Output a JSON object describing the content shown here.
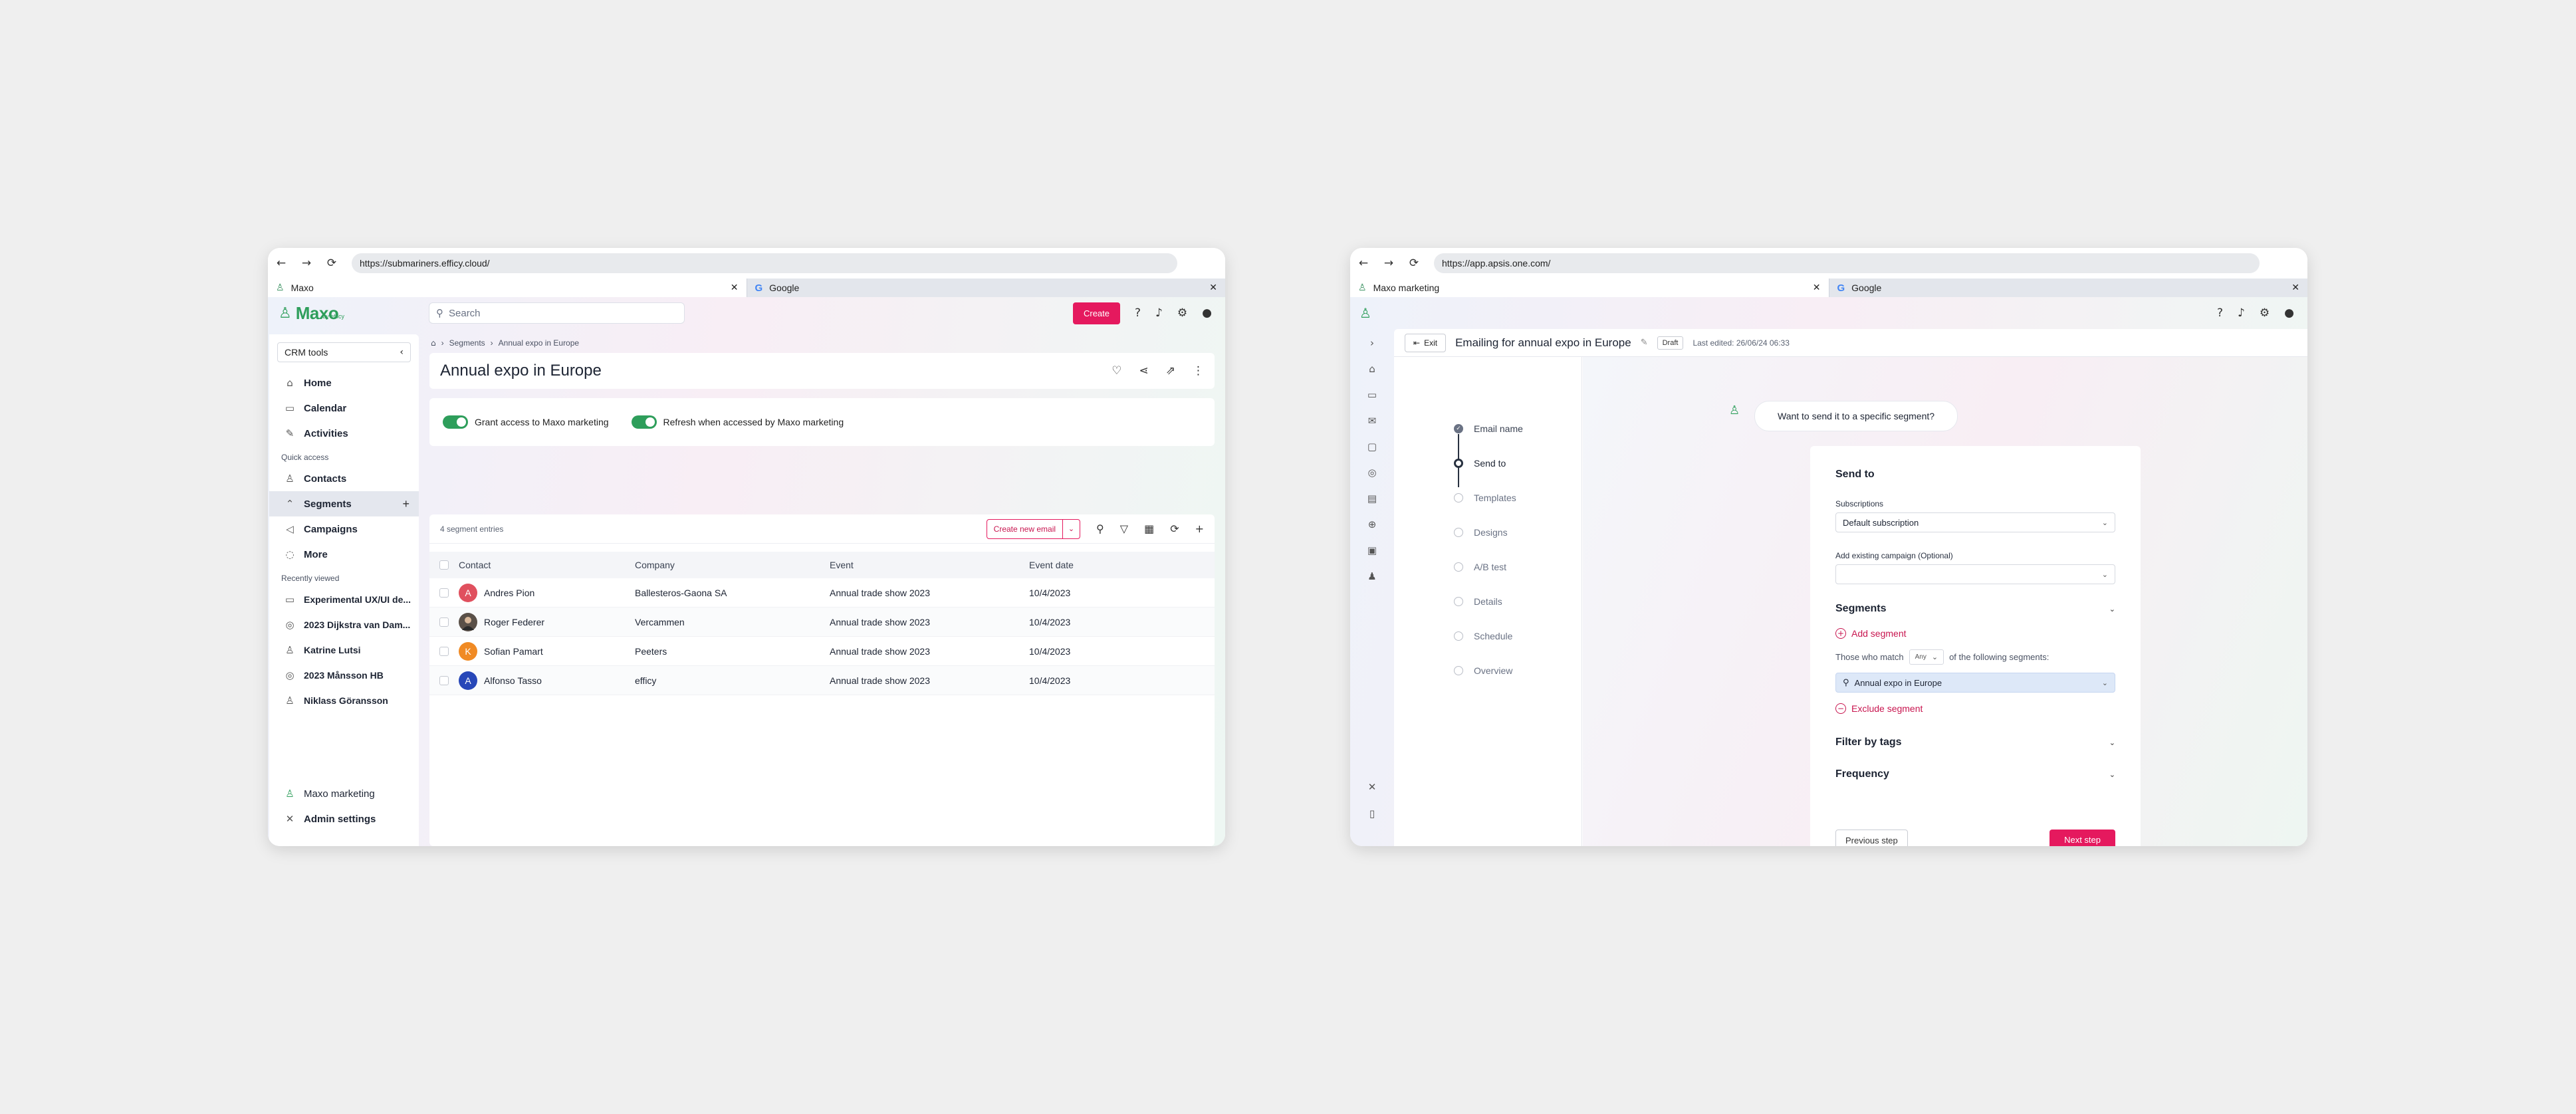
{
  "left_window": {
    "url": "https://submariners.efficy.cloud/",
    "tabs": [
      {
        "label": "Maxo"
      },
      {
        "label": "Google"
      }
    ],
    "brand": {
      "name": "Maxo",
      "by": "by efficy"
    },
    "search_placeholder": "Search",
    "create_label": "Create",
    "sidebar": {
      "crm_tools": "CRM tools",
      "main_items": [
        {
          "label": "Home",
          "icon": "home-icon"
        },
        {
          "label": "Calendar",
          "icon": "calendar-icon"
        },
        {
          "label": "Activities",
          "icon": "activities-icon"
        }
      ],
      "quick_access_title": "Quick access",
      "quick_items": [
        {
          "label": "Contacts",
          "icon": "contact-icon"
        },
        {
          "label": "Segments",
          "icon": "segments-icon"
        },
        {
          "label": "Campaigns",
          "icon": "megaphone-icon"
        },
        {
          "label": "More",
          "icon": "more-icon"
        }
      ],
      "recent_title": "Recently viewed",
      "recent_items": [
        {
          "label": "Experimental UX/UI de..."
        },
        {
          "label": "2023 Dijkstra van Dam..."
        },
        {
          "label": "Katrine Lutsi"
        },
        {
          "label": "2023 Månsson HB"
        },
        {
          "label": "Niklass Göransson"
        }
      ],
      "bottom_items": [
        {
          "label": "Maxo marketing"
        },
        {
          "label": "Admin settings"
        }
      ]
    },
    "breadcrumb": [
      "Segments",
      "Annual expo in Europe"
    ],
    "page_title": "Annual expo in Europe",
    "toggles": [
      {
        "label": "Grant access to Maxo marketing",
        "on": true
      },
      {
        "label": "Refresh when accessed by Maxo marketing",
        "on": true
      }
    ],
    "entries_label": "4 segment entries",
    "create_email_label": "Create new email",
    "table": {
      "columns": [
        "Contact",
        "Company",
        "Event",
        "Event date"
      ],
      "rows": [
        {
          "initial": "A",
          "color": "#e0505e",
          "contact": "Andres Pion",
          "company": "Ballesteros-Gaona SA",
          "event": "Annual trade show 2023",
          "date": "10/4/2023"
        },
        {
          "initial": "",
          "color": "#5a5048",
          "contact": "Roger Federer",
          "company": "Vercammen",
          "event": "Annual trade show 2023",
          "date": "10/4/2023"
        },
        {
          "initial": "K",
          "color": "#f08a24",
          "contact": "Sofian Pamart",
          "company": "Peeters",
          "event": "Annual trade show 2023",
          "date": "10/4/2023"
        },
        {
          "initial": "A",
          "color": "#2747b8",
          "contact": "Alfonso Tasso",
          "company": "efficy",
          "event": "Annual trade show 2023",
          "date": "10/4/2023"
        }
      ]
    }
  },
  "right_window": {
    "url": "https://app.apsis.one.com/",
    "tabs": [
      {
        "label": "Maxo marketing"
      },
      {
        "label": "Google"
      }
    ],
    "exit_label": "Exit",
    "title": "Emailing for annual expo in Europe",
    "badge": "Draft",
    "last_edited": "Last edited: 26/06/24 06:33",
    "steps": [
      {
        "label": "Email name",
        "state": "done"
      },
      {
        "label": "Send to",
        "state": "current"
      },
      {
        "label": "Templates",
        "state": "todo"
      },
      {
        "label": "Designs",
        "state": "todo"
      },
      {
        "label": "A/B test",
        "state": "todo"
      },
      {
        "label": "Details",
        "state": "todo"
      },
      {
        "label": "Schedule",
        "state": "todo"
      },
      {
        "label": "Overview",
        "state": "todo"
      }
    ],
    "bubble": "Want to send it to a specific segment?",
    "form": {
      "title": "Send to",
      "subscriptions_label": "Subscriptions",
      "subscriptions_value": "Default subscription",
      "campaign_label": "Add existing campaign (Optional)",
      "campaign_value": "",
      "segments_title": "Segments",
      "add_segment": "Add segment",
      "match_prefix": "Those who match",
      "match_value": "Any",
      "match_suffix": "of the following segments:",
      "segment_value": "Annual expo in Europe",
      "exclude_segment": "Exclude segment",
      "filter_tags": "Filter by tags",
      "frequency": "Frequency",
      "prev_label": "Previous step",
      "next_label": "Next step"
    }
  },
  "colors": {
    "brand_green": "#2e9e5b",
    "accent_pink": "#e5195e"
  }
}
